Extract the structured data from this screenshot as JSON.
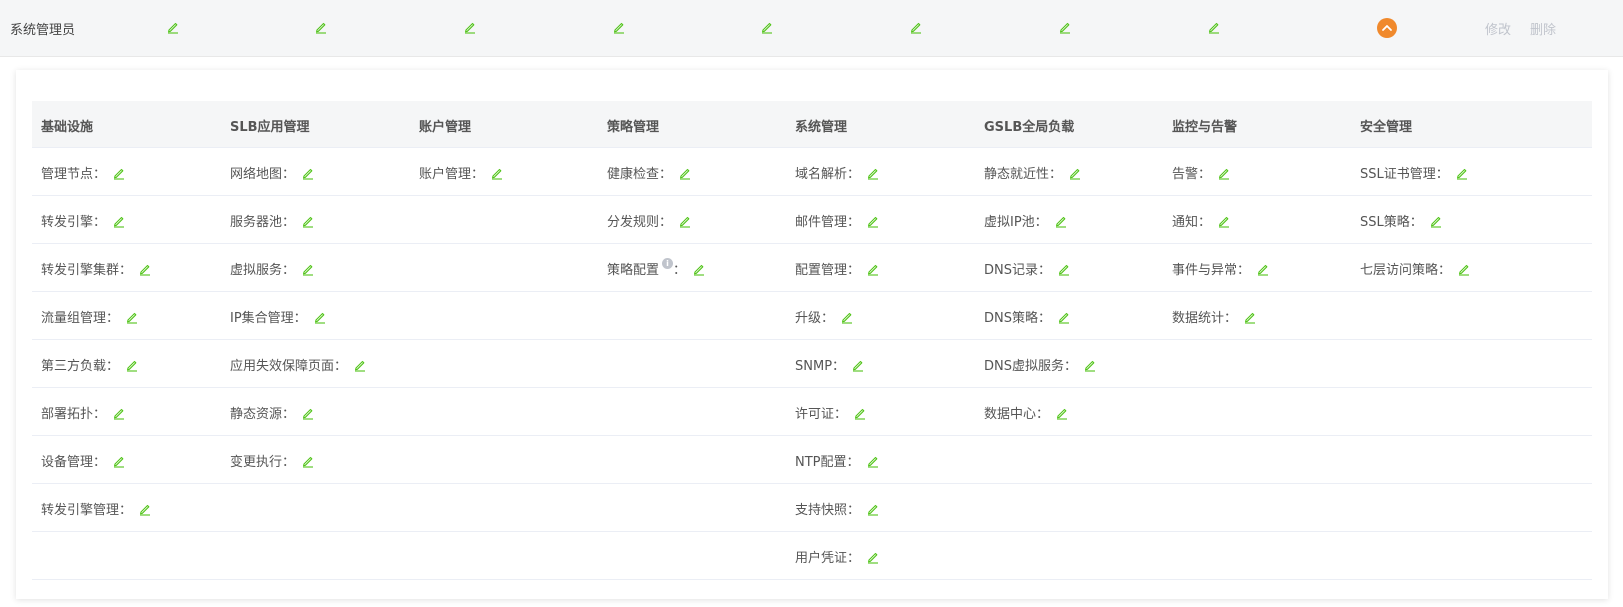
{
  "role": {
    "name": "系统管理员",
    "actions": {
      "edit": "修改",
      "delete": "删除"
    }
  },
  "columns": [
    {
      "title": "基础设施",
      "items": [
        "管理节点：",
        "转发引擎：",
        "转发引擎集群：",
        "流量组管理：",
        "第三方负载：",
        "部署拓扑：",
        "设备管理：",
        "转发引擎管理："
      ]
    },
    {
      "title": "SLB应用管理",
      "items": [
        "网络地图：",
        "服务器池：",
        "虚拟服务：",
        "IP集合管理：",
        "应用失效保障页面：",
        "静态资源：",
        "变更执行："
      ]
    },
    {
      "title": "账户管理",
      "items": [
        "账户管理："
      ]
    },
    {
      "title": "策略管理",
      "items": [
        "健康检查：",
        "分发规则：",
        "策略配置"
      ]
    },
    {
      "title": "系统管理",
      "items": [
        "域名解析：",
        "邮件管理：",
        "配置管理：",
        "升级：",
        "SNMP：",
        "许可证：",
        "NTP配置：",
        "支持快照：",
        "用户凭证："
      ]
    },
    {
      "title": "GSLB全局负载",
      "items": [
        "静态就近性：",
        "虚拟IP池：",
        "DNS记录：",
        "DNS策略：",
        "DNS虚拟服务：",
        "数据中心："
      ]
    },
    {
      "title": "监控与告警",
      "items": [
        "告警：",
        "通知：",
        "事件与异常：",
        "数据统计："
      ]
    },
    {
      "title": "安全管理",
      "items": [
        "SSL证书管理：",
        "SSL策略：",
        "七层访问策略："
      ]
    }
  ],
  "info_icon_text": "i",
  "colors": {
    "accent": "#f0892c",
    "edit_icon": "#52c41a",
    "muted": "#c0c4cc"
  }
}
